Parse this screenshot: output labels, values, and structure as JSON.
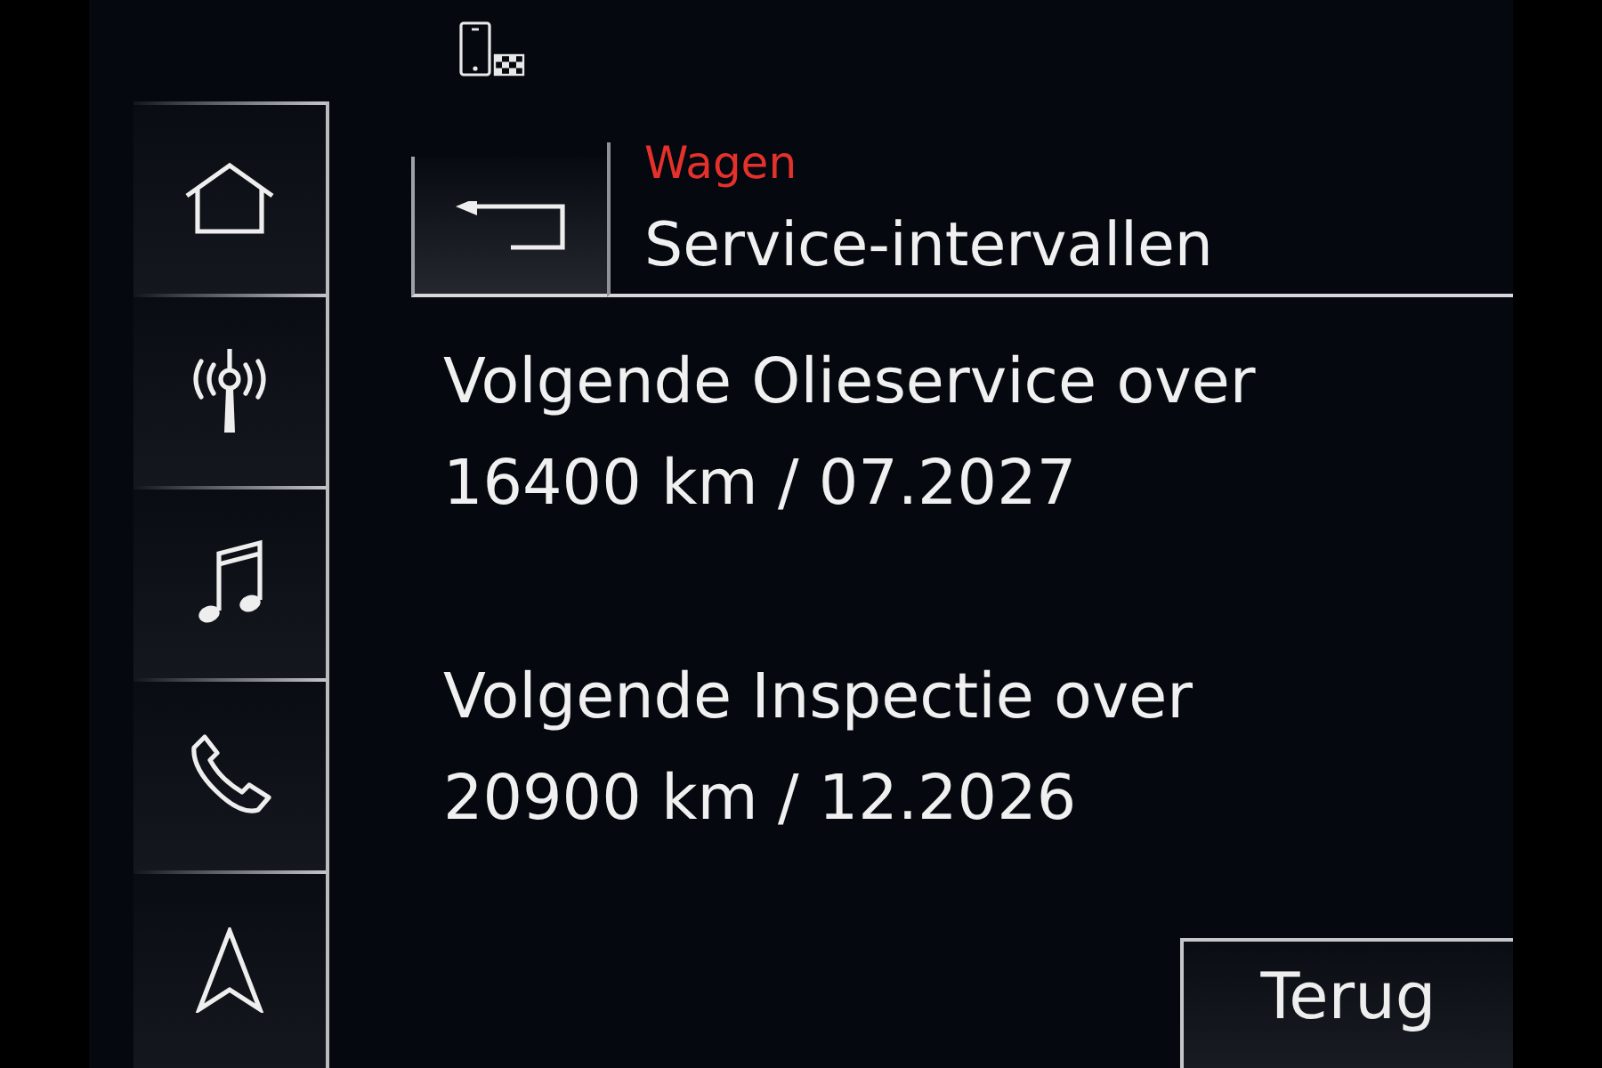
{
  "sidebar": {
    "items": [
      {
        "kind": "home",
        "selected": false
      },
      {
        "kind": "radio",
        "selected": false
      },
      {
        "kind": "music",
        "selected": false
      },
      {
        "kind": "phone",
        "selected": false
      },
      {
        "kind": "navigation",
        "selected": false
      }
    ]
  },
  "header": {
    "breadcrumb": "Wagen",
    "title": "Service-intervallen"
  },
  "services": [
    {
      "label": "Volgende Olieservice over",
      "value": "16400 km / 07.2027"
    },
    {
      "label": "Volgende Inspectie over",
      "value": "20900 km / 12.2026"
    }
  ],
  "back_button": {
    "label": "Terug"
  }
}
